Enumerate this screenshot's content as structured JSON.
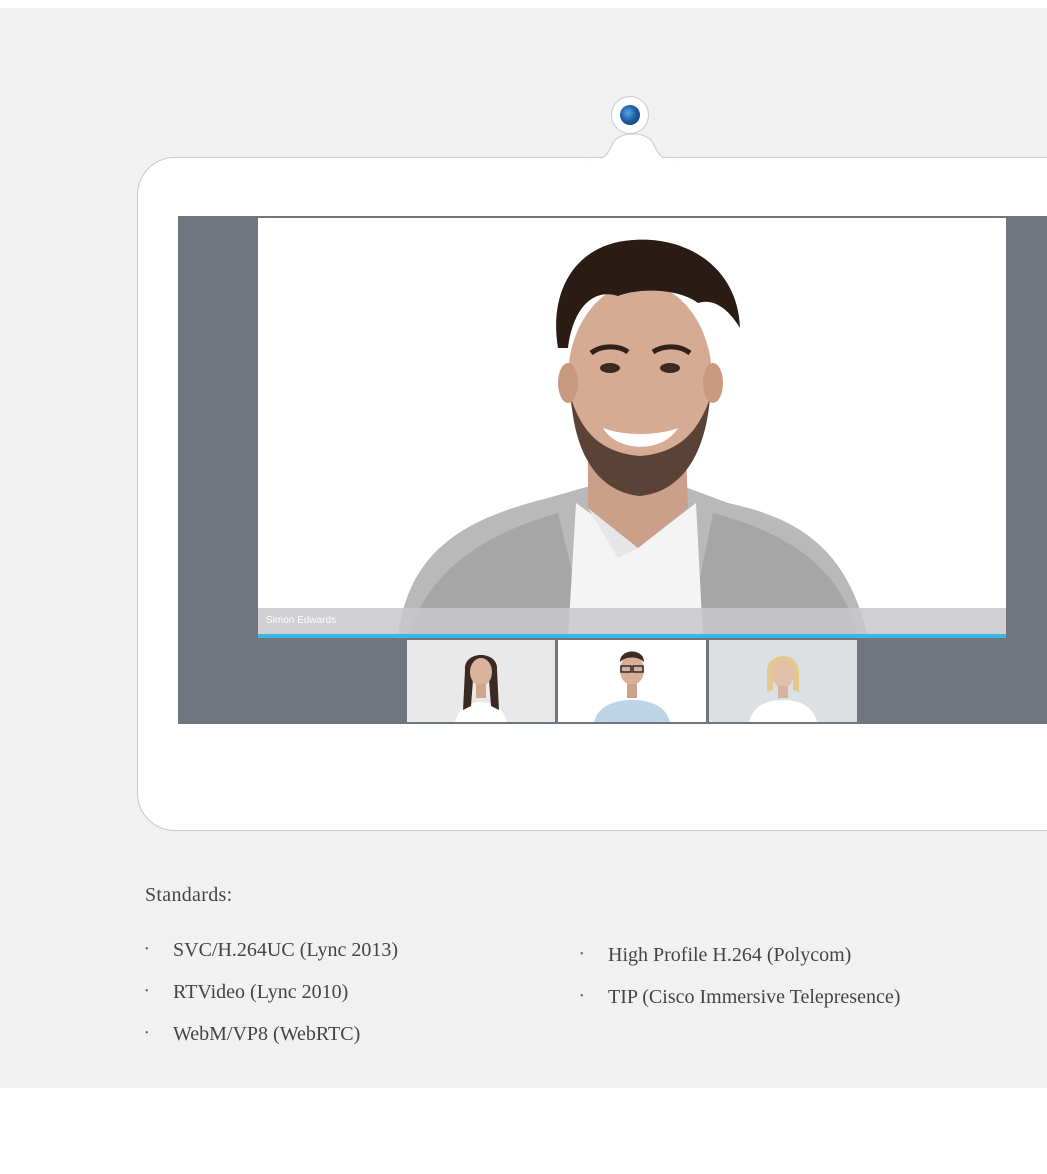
{
  "main_video": {
    "caption": "Simon Edwards"
  },
  "thumbnails": [
    {
      "label": "participant-woman-brunette"
    },
    {
      "label": "participant-man-glasses"
    },
    {
      "label": "participant-woman-blonde"
    }
  ],
  "standards": {
    "title": "Standards:",
    "col1": [
      "SVC/H.264UC (Lync 2013)",
      "RTVideo (Lync 2010)",
      "WebM/VP8 (WebRTC)"
    ],
    "col2": [
      "High Profile H.264 (Polycom)",
      "TIP (Cisco Immersive Telepresence)"
    ]
  },
  "colors": {
    "background": "#f1f1f1",
    "screen": "#6f7680",
    "accent": "#3bb6e4",
    "lens": "#1f5fa8"
  }
}
